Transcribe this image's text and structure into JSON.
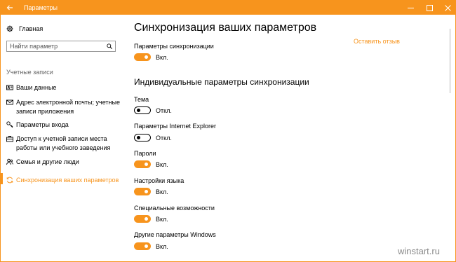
{
  "window": {
    "title": "Параметры"
  },
  "sidebar": {
    "home": "Главная",
    "search_placeholder": "Найти параметр",
    "section": "Учетные записи",
    "items": [
      {
        "label": "Ваши данные",
        "icon": "person-card-icon"
      },
      {
        "label": "Адрес электронной почты; учетные записи приложения",
        "icon": "mail-icon"
      },
      {
        "label": "Параметры входа",
        "icon": "key-icon"
      },
      {
        "label": "Доступ к учетной записи места работы или учебного заведения",
        "icon": "briefcase-icon"
      },
      {
        "label": "Семья и другие люди",
        "icon": "people-icon"
      },
      {
        "label": "Синхронизация ваших параметров",
        "icon": "sync-icon",
        "active": true
      }
    ]
  },
  "main": {
    "title": "Синхронизация ваших параметров",
    "feedback_link": "Оставить отзыв",
    "sync_settings": {
      "label": "Параметры синхронизации",
      "state": "Вкл.",
      "on": true
    },
    "individual_title": "Индивидуальные параметры синхронизации",
    "settings": [
      {
        "label": "Тема",
        "state": "Откл.",
        "on": false
      },
      {
        "label": "Параметры Internet Explorer",
        "state": "Откл.",
        "on": false
      },
      {
        "label": "Пароли",
        "state": "Вкл.",
        "on": true
      },
      {
        "label": "Настройки языка",
        "state": "Вкл.",
        "on": true
      },
      {
        "label": "Специальные возможности",
        "state": "Вкл.",
        "on": true
      },
      {
        "label": "Другие параметры Windows",
        "state": "Вкл.",
        "on": true
      }
    ]
  },
  "watermark": "winstart.ru",
  "colors": {
    "accent": "#f7941d",
    "background": "#ffffff",
    "text": "#000000"
  }
}
